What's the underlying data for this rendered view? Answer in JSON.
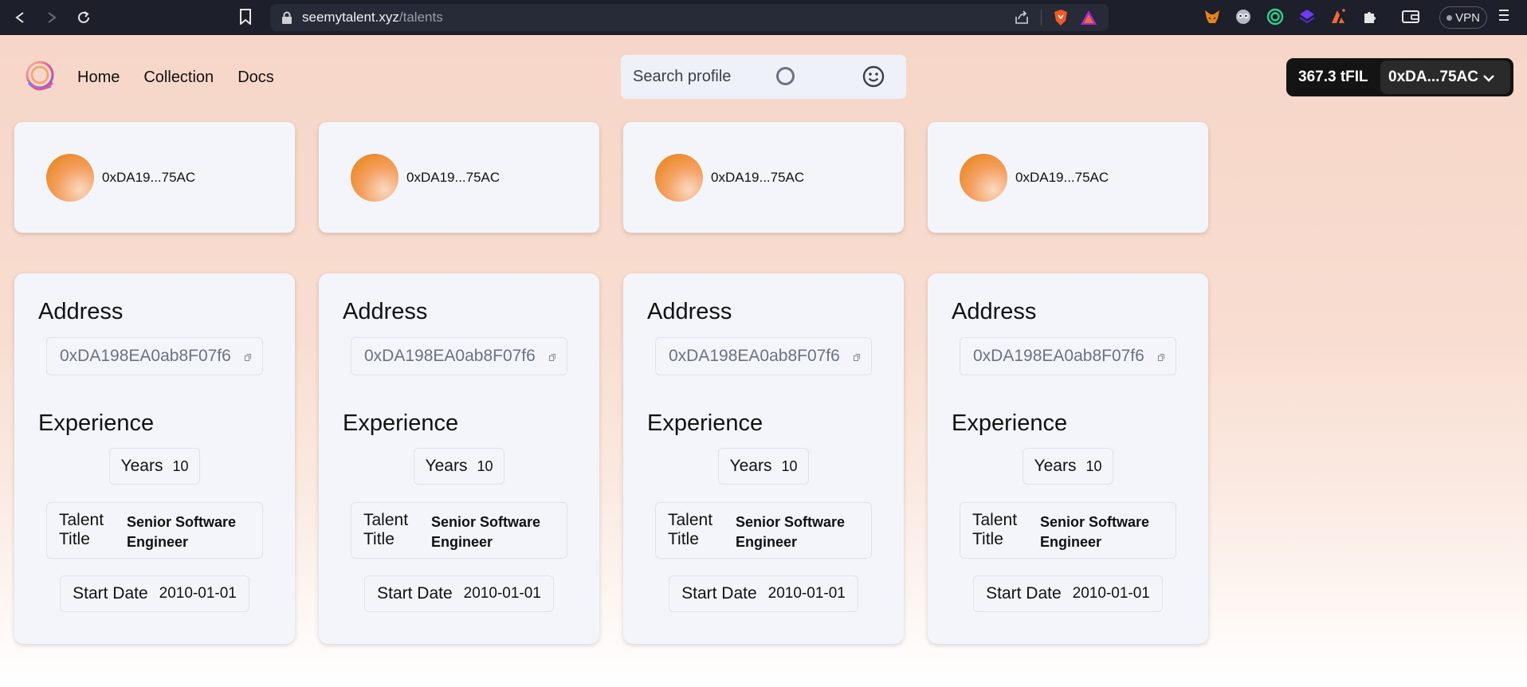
{
  "browser": {
    "url_host": "seemytalent.xyz",
    "url_path": "/talents",
    "vpn_label": "VPN"
  },
  "nav": {
    "items": [
      "Home",
      "Collection",
      "Docs"
    ]
  },
  "search": {
    "placeholder": "Search profile"
  },
  "wallet": {
    "balance": "367.3 tFIL",
    "account": "0xDA...75AC"
  },
  "profiles": [
    {
      "short_address": "0xDA19...75AC"
    },
    {
      "short_address": "0xDA19...75AC"
    },
    {
      "short_address": "0xDA19...75AC"
    },
    {
      "short_address": "0xDA19...75AC"
    }
  ],
  "cards": [
    {
      "address_heading": "Address",
      "address": "0xDA198EA0ab8F07f6",
      "experience_heading": "Experience",
      "years_label": "Years",
      "years": "10",
      "talent_title_label": "Talent Title",
      "talent_title": "Senior Software Engineer",
      "start_date_label": "Start Date",
      "start_date": "2010-01-01"
    },
    {
      "address_heading": "Address",
      "address": "0xDA198EA0ab8F07f6",
      "experience_heading": "Experience",
      "years_label": "Years",
      "years": "10",
      "talent_title_label": "Talent Title",
      "talent_title": "Senior Software Engineer",
      "start_date_label": "Start Date",
      "start_date": "2010-01-01"
    },
    {
      "address_heading": "Address",
      "address": "0xDA198EA0ab8F07f6",
      "experience_heading": "Experience",
      "years_label": "Years",
      "years": "10",
      "talent_title_label": "Talent Title",
      "talent_title": "Senior Software Engineer",
      "start_date_label": "Start Date",
      "start_date": "2010-01-01"
    },
    {
      "address_heading": "Address",
      "address": "0xDA198EA0ab8F07f6",
      "experience_heading": "Experience",
      "years_label": "Years",
      "years": "10",
      "talent_title_label": "Talent Title",
      "talent_title": "Senior Software Engineer",
      "start_date_label": "Start Date",
      "start_date": "2010-01-01"
    }
  ],
  "colors": {
    "page_top": "#f6d6c8",
    "card_bg": "#f4f5fb",
    "wallet_bg": "#141414",
    "avatar_orange": "#ea8a2a"
  }
}
